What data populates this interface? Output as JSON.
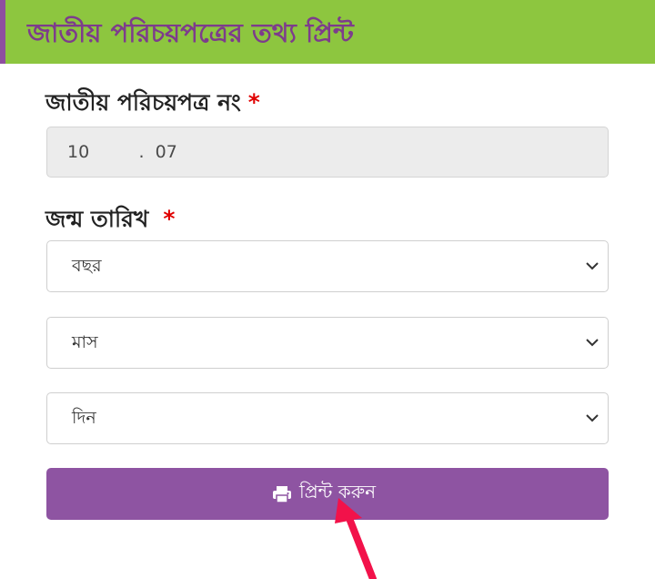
{
  "header": {
    "title": "জাতীয় পরিচয়পত্রের তথ্য প্রিন্ট"
  },
  "form": {
    "nid_label": "জাতীয় পরিচয়পত্র নং",
    "nid_value": "10         .  07",
    "dob_label": "জন্ম তারিখ",
    "required_mark": "*",
    "year_select": {
      "selected": "বছর"
    },
    "month_select": {
      "selected": "মাস"
    },
    "day_select": {
      "selected": "দিন"
    },
    "print_button_label": "প্রিন্ট করুন"
  },
  "colors": {
    "header_bg": "#8dc63f",
    "header_text": "#7d3c8c",
    "button_bg": "#8e54a2",
    "required": "#e00000",
    "annotation_arrow": "#f2124a"
  },
  "icons": {
    "print": "printer-icon",
    "dropdown": "chevron-down-icon"
  }
}
